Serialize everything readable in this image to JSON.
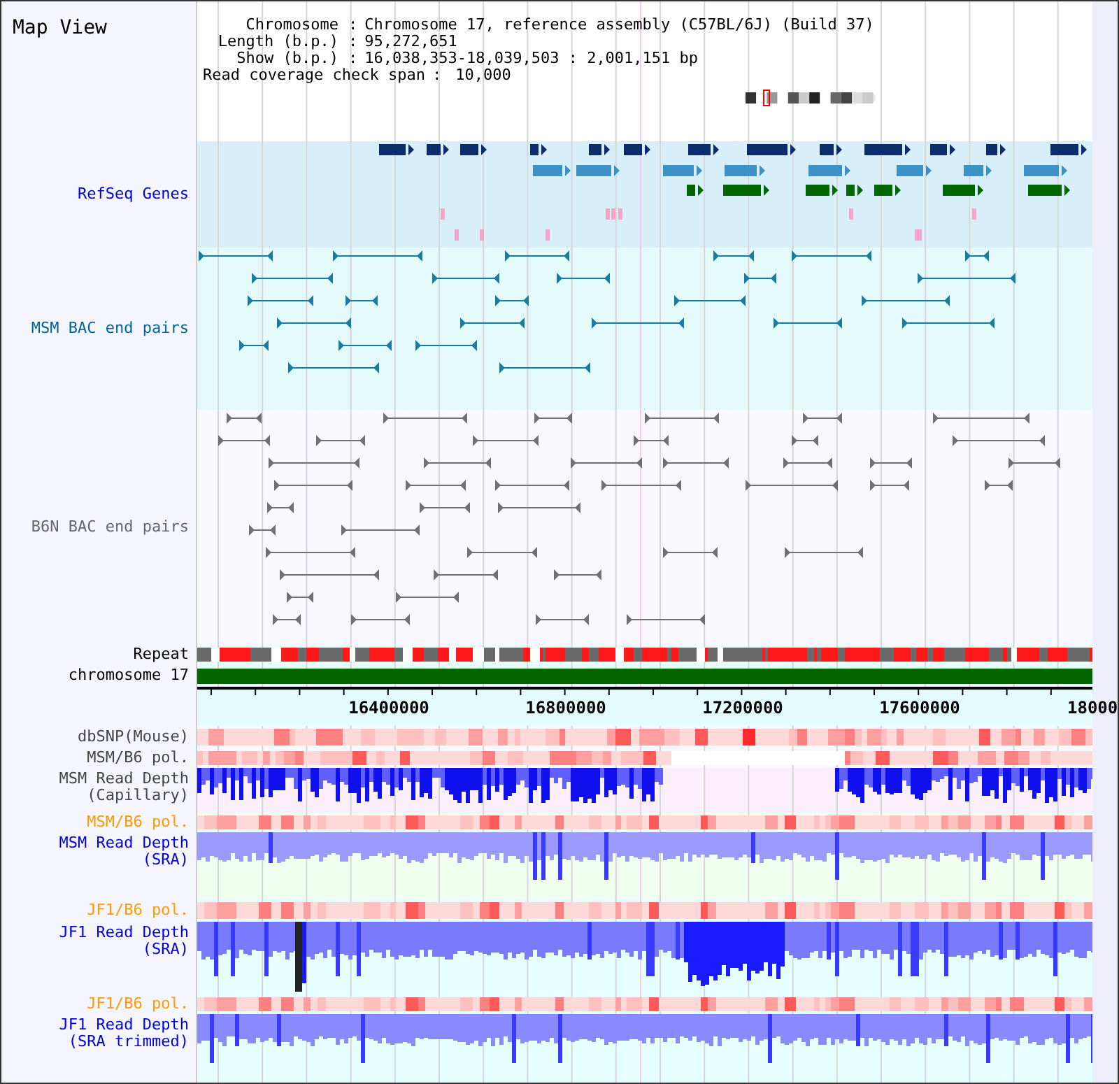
{
  "title": "Map View",
  "header": {
    "rows": [
      {
        "label": "Chromosome",
        "sep": ":",
        "value": "Chromosome 17, reference assembly (C57BL/6J) (Build 37)"
      },
      {
        "label": "Length (b.p.)",
        "sep": ":",
        "value": "95,272,651"
      },
      {
        "label": "Show (b.p.)",
        "sep": ":",
        "value": "16,038,353-18,039,503 : 2,001,151 bp"
      },
      {
        "label": "Read coverage check span",
        "sep": ":",
        "value": "10,000"
      }
    ]
  },
  "tracks": [
    {
      "label": [
        "RefSeq Genes"
      ],
      "kind": "genes",
      "color": "#0000cc"
    },
    {
      "label": [
        "MSM BAC end pairs"
      ],
      "kind": "pairs",
      "color": "#006699"
    },
    {
      "label": [
        "B6N BAC end pairs"
      ],
      "kind": "pairs",
      "color": "#666666"
    },
    {
      "label": [
        "Repeat"
      ],
      "kind": "repeat",
      "color": "#000000"
    },
    {
      "label": [
        "chromosome 17"
      ],
      "kind": "chromosome",
      "color": "#000000"
    },
    {
      "kind": "axis",
      "ticks": [
        "16400000",
        "16800000",
        "17200000",
        "17600000",
        "18000"
      ]
    },
    {
      "label": [
        "dbSNP(Mouse)"
      ],
      "kind": "heat",
      "color": "#444444"
    },
    {
      "label": [
        "MSM/B6 pol."
      ],
      "kind": "heat",
      "color": "#444444"
    },
    {
      "label": [
        "MSM Read Depth",
        "(Capillary)"
      ],
      "kind": "depth",
      "color": "#444444"
    },
    {
      "label": [
        "MSM/B6 pol."
      ],
      "kind": "heat",
      "color": "#ff9900"
    },
    {
      "label": [
        "MSM Read Depth",
        "(SRA)"
      ],
      "kind": "depth",
      "color": "#0000dd"
    },
    {
      "label": [
        "JF1/B6 pol."
      ],
      "kind": "heat",
      "color": "#ff9900"
    },
    {
      "label": [
        "JF1 Read Depth",
        "(SRA)"
      ],
      "kind": "depth",
      "color": "#0000dd"
    },
    {
      "label": [
        "JF1/B6 pol."
      ],
      "kind": "heat",
      "color": "#ff9900"
    },
    {
      "label": [
        "JF1 Read Depth",
        "(SRA trimmed)"
      ],
      "kind": "depth",
      "color": "#0000dd"
    }
  ]
}
